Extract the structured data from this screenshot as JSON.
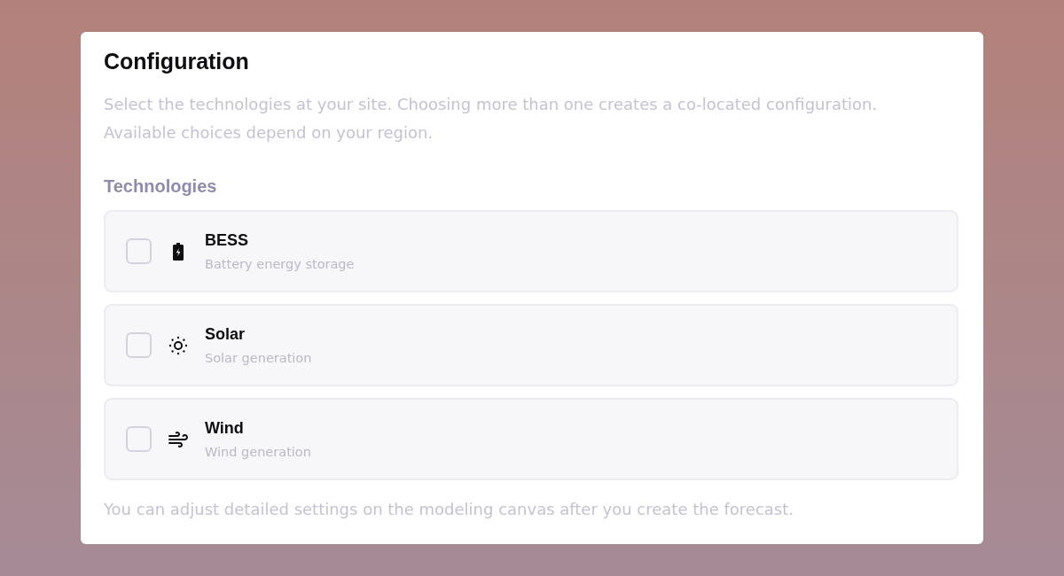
{
  "card": {
    "title": "Configuration",
    "description": "Select the technologies at your site. Choosing more than one creates a co-located configuration. Available choices depend on your region.",
    "section_label": "Technologies",
    "options": [
      {
        "kind": "battery",
        "label": "BESS",
        "sublabel": "Battery energy storage",
        "checked": false
      },
      {
        "kind": "sun",
        "label": "Solar",
        "sublabel": "Solar generation",
        "checked": false
      },
      {
        "kind": "wind",
        "label": "Wind",
        "sublabel": "Wind generation",
        "checked": false
      }
    ],
    "footnote": "You can adjust detailed settings on the modeling canvas after you create the forecast."
  }
}
